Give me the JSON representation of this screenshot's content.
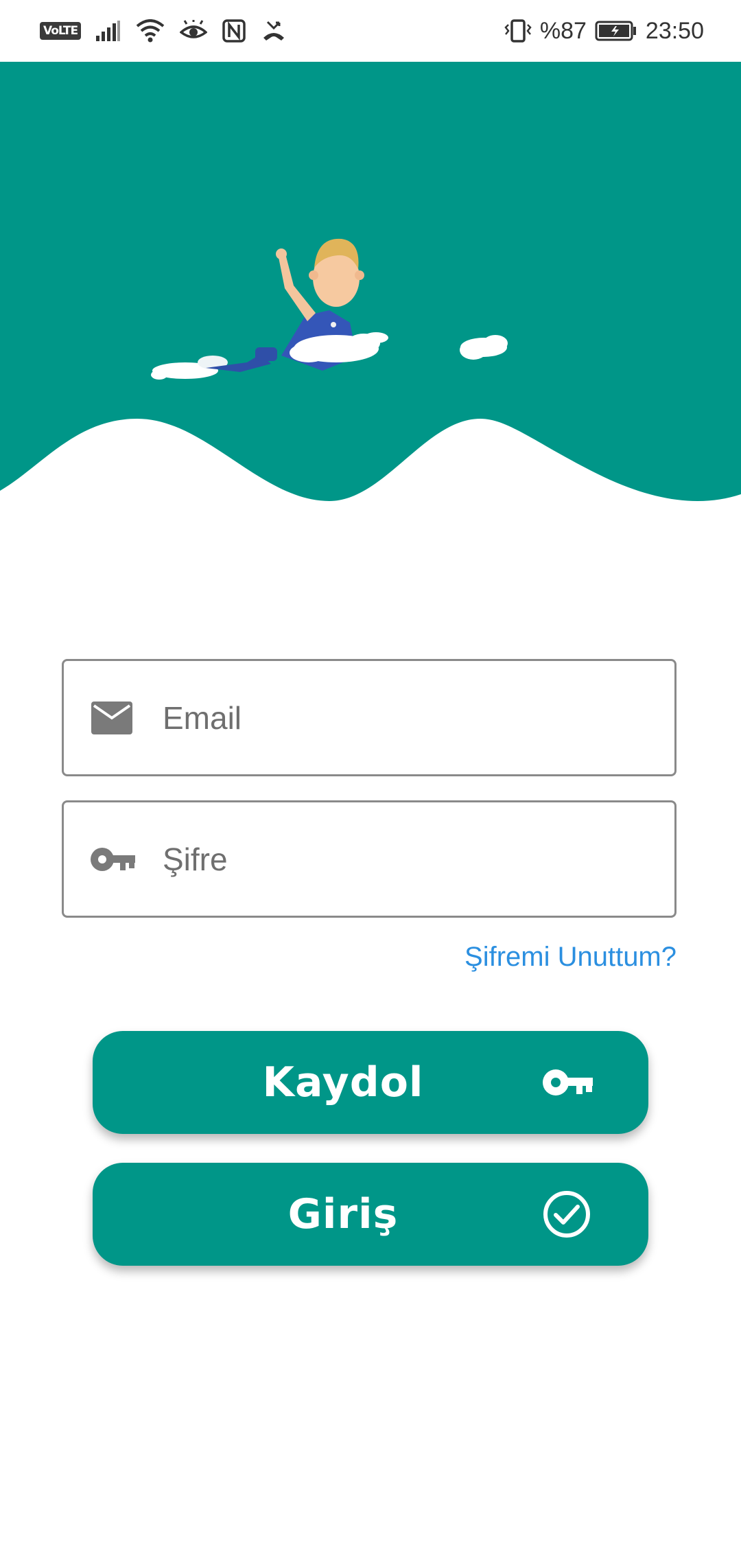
{
  "status_bar": {
    "network_badge": "VoLTE",
    "battery_percent": "%87",
    "time": "23:50",
    "icons": [
      "signal-icon",
      "wifi-icon",
      "eye-comfort-icon",
      "nfc-icon",
      "missed-call-icon",
      "vibrate-icon",
      "battery-charging-icon"
    ]
  },
  "colors": {
    "primary": "#009688",
    "link": "#2b8fe0",
    "placeholder": "#6f6f6f",
    "border": "#8a8a8a"
  },
  "form": {
    "email_placeholder": "Email",
    "password_placeholder": "Şifre",
    "forgot_password": "Şifremi Unuttum?",
    "email_icon": "mail-icon",
    "password_icon": "key-icon"
  },
  "buttons": {
    "register_label": "Kaydol",
    "register_icon": "key-icon",
    "login_label": "Giriş",
    "login_icon": "check-circle-icon"
  }
}
